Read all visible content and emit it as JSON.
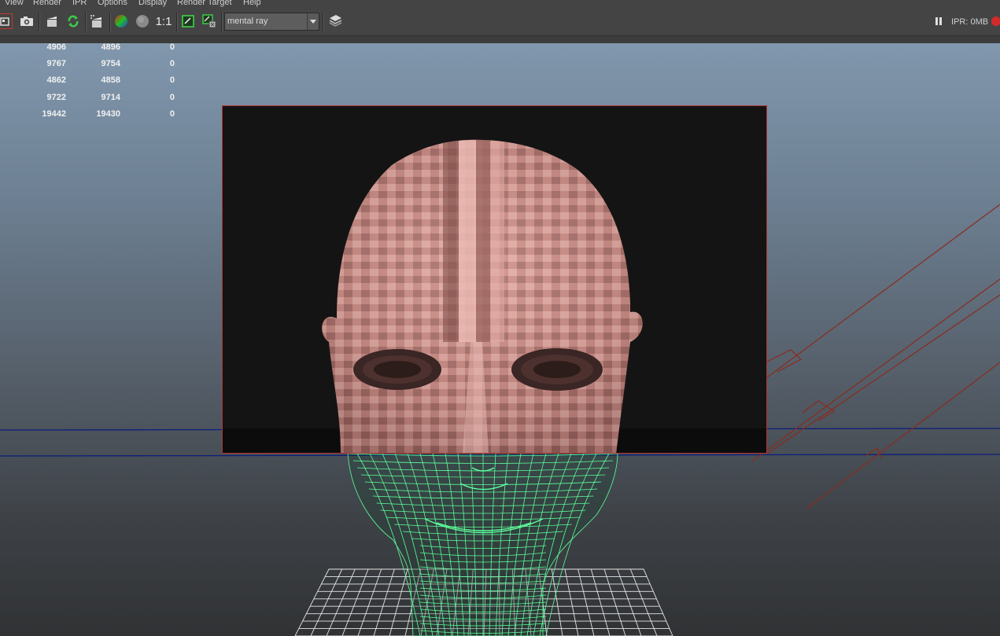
{
  "menu": {
    "items": [
      {
        "label": "View"
      },
      {
        "label": "Render"
      },
      {
        "label": "IPR"
      },
      {
        "label": "Options"
      },
      {
        "label": "Display"
      },
      {
        "label": "Render Target"
      },
      {
        "label": "Help"
      }
    ]
  },
  "toolbar": {
    "renderer": "mental ray",
    "ratio_label": "1:1",
    "ipr_memory": "IPR: 0MB"
  },
  "stats": {
    "rows": [
      [
        "4906",
        "4896",
        "0"
      ],
      [
        "9767",
        "9754",
        "0"
      ],
      [
        "4862",
        "4858",
        "0"
      ],
      [
        "9722",
        "9714",
        "0"
      ],
      [
        "19442",
        "19430",
        "0"
      ]
    ]
  },
  "colors": {
    "wireframe": "#5dff9c",
    "render_border": "#b03232",
    "camera_lines": "#8a2b1e",
    "horizon_lines": "#0c1e7a",
    "skin": "#c98a84"
  },
  "icons": [
    "render-sequence-icon",
    "snapshot-icon",
    "clapper-icon",
    "refresh-ipr-icon",
    "render-settings-icon",
    "rgb-channels-icon",
    "alpha-channel-icon",
    "render-region-icon",
    "keep-image-icon",
    "dropdown-arrow-icon",
    "render-view-icon",
    "pause-ipr-icon",
    "stop-render-icon"
  ]
}
